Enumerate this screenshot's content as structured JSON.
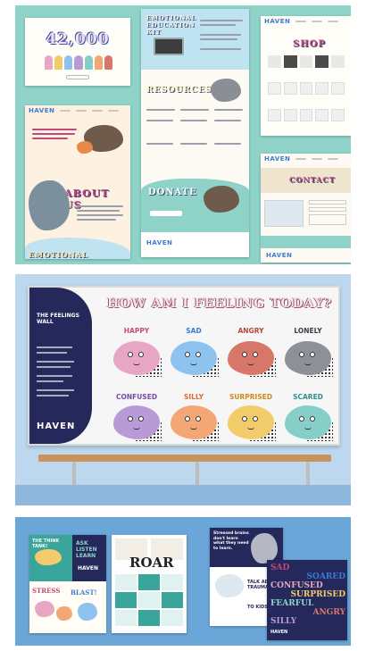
{
  "panel1": {
    "counter": "42,000",
    "logo": "HAVEN",
    "kit_title": "EMOTIONAL EDUCATION KIT",
    "shop_title": "SHOP",
    "resources_title": "RESOURCES",
    "about_title": "ABOUT US",
    "contact_title": "CONTACT",
    "donate_title": "DONATE",
    "emotional_title": "EMOTIONAL"
  },
  "panel2": {
    "heading": "HOW AM I FEELING TODAY?",
    "side_title": "THE FEELINGS WALL",
    "logo": "HAVEN",
    "emotions": [
      {
        "label": "HAPPY",
        "color": "#c94a7c",
        "face": "#e6a6c4"
      },
      {
        "label": "SAD",
        "color": "#3b7bd1",
        "face": "#8ec2ef"
      },
      {
        "label": "ANGRY",
        "color": "#b9443b",
        "face": "#d7776a"
      },
      {
        "label": "LONELY",
        "color": "#3a3f4a",
        "face": "#8c9097"
      },
      {
        "label": "CONFUSED",
        "color": "#7a4aa6",
        "face": "#b89ad6"
      },
      {
        "label": "SILLY",
        "color": "#e06e2e",
        "face": "#f2a774"
      },
      {
        "label": "SURPRISED",
        "color": "#d08a18",
        "face": "#f2cc6a"
      },
      {
        "label": "SCARED",
        "color": "#2f8f8a",
        "face": "#86cfc8"
      }
    ]
  },
  "panel3": {
    "brochure1_a": "THE THINK TANK!",
    "brochure1_b": "ASK LISTEN LEARN",
    "brochure1_logo": "HAVEN",
    "brochure1_c": "STRESS",
    "brochure1_d": "BLAST!",
    "brochure2_word": "ROAR",
    "poster_a": "Stressed brains don't learn what they need to learn.",
    "poster_b": "TALK ABOUT TRAUMA",
    "poster_c": "TO KIDS!",
    "poster_words": [
      "SAD",
      "SOARED",
      "CONFUSED",
      "SURPRISED",
      "FEARFUL",
      "ANGRY",
      "SILLY"
    ],
    "poster_logo": "HAVEN"
  }
}
